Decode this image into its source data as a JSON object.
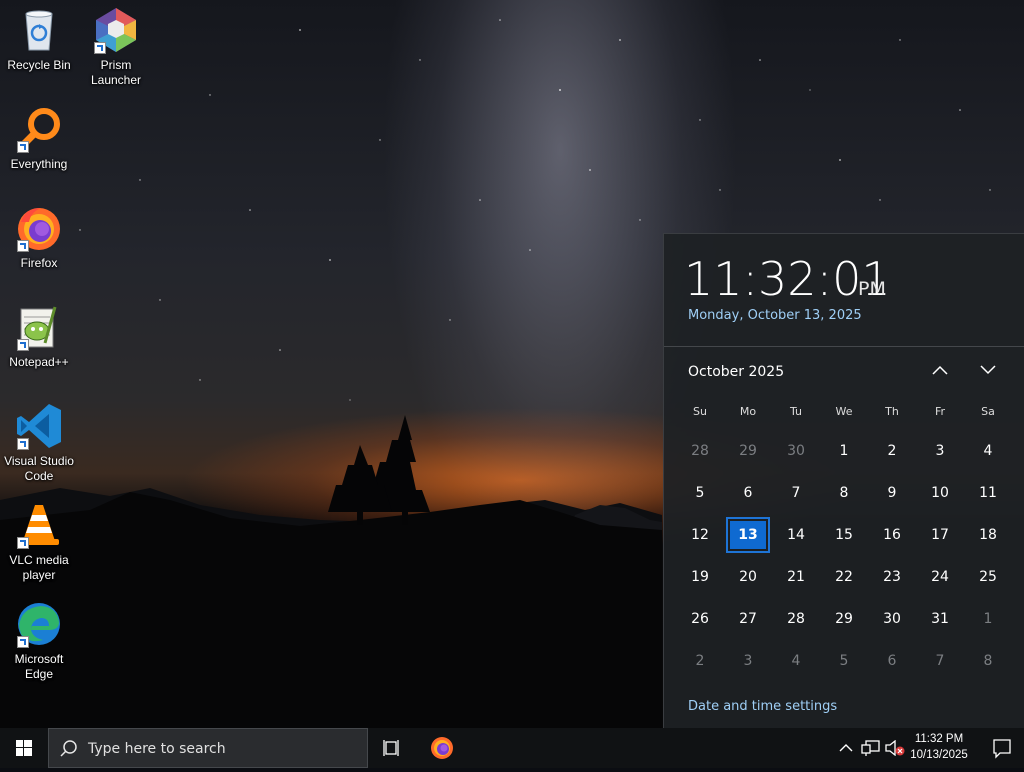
{
  "desktop": {
    "icons": [
      {
        "label": "Recycle Bin",
        "icon": "recycle-bin-icon"
      },
      {
        "label": "Prism Launcher",
        "icon": "prism-launcher-icon"
      },
      {
        "label": "Everything",
        "icon": "everything-icon"
      },
      {
        "label": "Firefox",
        "icon": "firefox-icon"
      },
      {
        "label": "Notepad++",
        "icon": "notepad-plus-plus-icon"
      },
      {
        "label": "Visual Studio Code",
        "icon": "vscode-icon"
      },
      {
        "label": "VLC media player",
        "icon": "vlc-icon"
      },
      {
        "label": "Microsoft Edge",
        "icon": "edge-icon"
      }
    ]
  },
  "flyout": {
    "time": "11:32:01",
    "ampm": "PM",
    "date": "Monday, October 13, 2025",
    "month_label": "October 2025",
    "weekdays": [
      "Su",
      "Mo",
      "Tu",
      "We",
      "Th",
      "Fr",
      "Sa"
    ],
    "weeks": [
      [
        {
          "d": "28",
          "o": true
        },
        {
          "d": "29",
          "o": true
        },
        {
          "d": "30",
          "o": true
        },
        {
          "d": "1"
        },
        {
          "d": "2"
        },
        {
          "d": "3"
        },
        {
          "d": "4"
        }
      ],
      [
        {
          "d": "5"
        },
        {
          "d": "6"
        },
        {
          "d": "7"
        },
        {
          "d": "8"
        },
        {
          "d": "9"
        },
        {
          "d": "10"
        },
        {
          "d": "11"
        }
      ],
      [
        {
          "d": "12"
        },
        {
          "d": "13",
          "today": true
        },
        {
          "d": "14"
        },
        {
          "d": "15"
        },
        {
          "d": "16"
        },
        {
          "d": "17"
        },
        {
          "d": "18"
        }
      ],
      [
        {
          "d": "19"
        },
        {
          "d": "20"
        },
        {
          "d": "21"
        },
        {
          "d": "22"
        },
        {
          "d": "23"
        },
        {
          "d": "24"
        },
        {
          "d": "25"
        }
      ],
      [
        {
          "d": "26"
        },
        {
          "d": "27"
        },
        {
          "d": "28"
        },
        {
          "d": "29"
        },
        {
          "d": "30"
        },
        {
          "d": "31"
        },
        {
          "d": "1",
          "o": true
        }
      ],
      [
        {
          "d": "2",
          "o": true
        },
        {
          "d": "3",
          "o": true
        },
        {
          "d": "4",
          "o": true
        },
        {
          "d": "5",
          "o": true
        },
        {
          "d": "6",
          "o": true
        },
        {
          "d": "7",
          "o": true
        },
        {
          "d": "8",
          "o": true
        }
      ]
    ],
    "settings_link": "Date and time settings"
  },
  "taskbar": {
    "search_placeholder": "Type here to search",
    "tray_time": "11:32 PM",
    "tray_date": "10/13/2025",
    "tray_icons": [
      "chevron-up-icon",
      "network-icon",
      "volume-muted-icon"
    ]
  },
  "colors": {
    "accent": "#0f6ad1",
    "link": "#9fcff6",
    "flyout_bg": "#1e2124",
    "taskbar_bg": "#101214"
  }
}
